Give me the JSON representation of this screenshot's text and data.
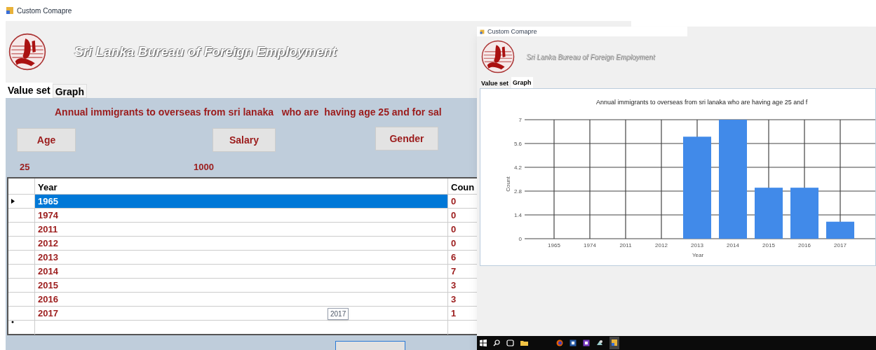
{
  "window": {
    "title": "Custom Comapre"
  },
  "header": {
    "title": "Sri Lanka Bureau of Foreign Employment"
  },
  "tabs": [
    {
      "label": "Value set",
      "selected": true
    },
    {
      "label": "Graph",
      "selected": false
    }
  ],
  "description": "Annual immigrants to overseas from sri lanaka   who are  having age 25 and for sal",
  "filters": [
    {
      "label": "Age",
      "value": "25"
    },
    {
      "label": "Salary",
      "value": "1000"
    },
    {
      "label": "Gender"
    }
  ],
  "table": {
    "columns": [
      "Year",
      "Coun"
    ],
    "rows": [
      {
        "year": "1965",
        "count": "0",
        "selected": true
      },
      {
        "year": "1974",
        "count": "0",
        "selected": false
      },
      {
        "year": "2011",
        "count": "0",
        "selected": false
      },
      {
        "year": "2012",
        "count": "0",
        "selected": false
      },
      {
        "year": "2013",
        "count": "6",
        "selected": false
      },
      {
        "year": "2014",
        "count": "7",
        "selected": false
      },
      {
        "year": "2015",
        "count": "3",
        "selected": false
      },
      {
        "year": "2016",
        "count": "3",
        "selected": false
      },
      {
        "year": "2017",
        "count": "1",
        "selected": false
      }
    ],
    "tooltip": "2017"
  },
  "graph_window": {
    "title": "Custom Comapre",
    "header_title": "Sri Lanka Bureau of Foreign Employment",
    "tabs": [
      {
        "label": "Value set",
        "selected": false
      },
      {
        "label": "Graph",
        "selected": true
      }
    ],
    "chart_data": {
      "type": "bar",
      "title": "Annual immigrants to overseas from sri lanaka   who are having age 25 and f",
      "xlabel": "Year",
      "ylabel": "Count",
      "categories": [
        "1965",
        "1974",
        "2011",
        "2012",
        "2013",
        "2014",
        "2015",
        "2016",
        "2017"
      ],
      "series": [
        {
          "color": "#418ae9",
          "values": [
            0,
            0,
            0,
            0,
            6,
            7,
            3,
            3,
            1
          ]
        }
      ],
      "grid": true,
      "ylim": [
        0,
        7
      ],
      "yticks": [
        0,
        1.4,
        2.8,
        4.2,
        5.6,
        7
      ]
    }
  }
}
